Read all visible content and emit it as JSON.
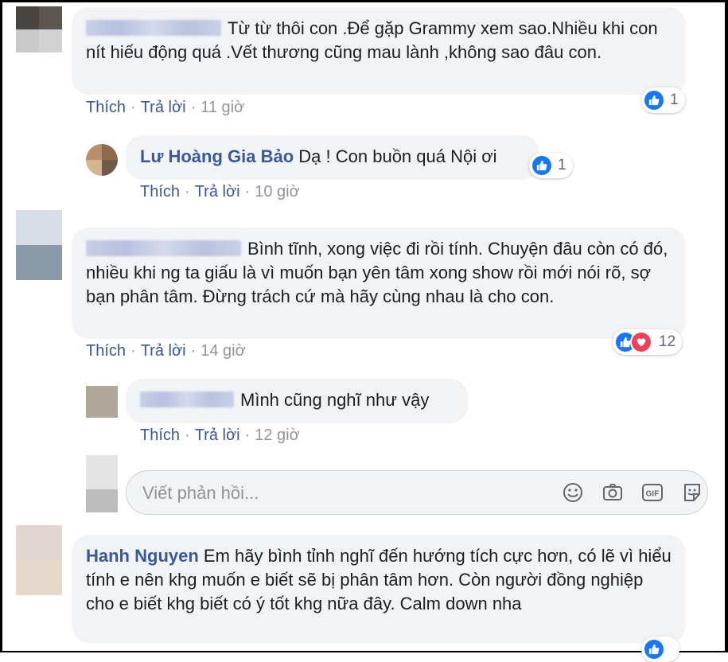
{
  "comments": [
    {
      "text": "Từ từ thôi con .Để gặp Grammy xem sao.Nhiều khi con nít hiếu động quá .Vết thương cũng mau lành ,không sao đâu con.",
      "like_label": "Thích",
      "reply_label": "Trả lời",
      "time": "11 giờ",
      "reaction_count": "1"
    },
    {
      "author": "Lư Hoàng Gia Bảo",
      "text": "Dạ ! Con buồn quá Nội ơi",
      "like_label": "Thích",
      "reply_label": "Trả lời",
      "time": "10 giờ",
      "reaction_count": "1"
    },
    {
      "text": "Bình tĩnh, xong việc đi rồi tính. Chuyện đâu còn có đó, nhiều khi ng ta giấu là vì muốn bạn yên tâm xong show rồi mới nói rõ, sợ bạn phân tâm. Đừng trách cứ mà hãy cùng nhau là cho con.",
      "like_label": "Thích",
      "reply_label": "Trả lời",
      "time": "14 giờ",
      "reaction_count": "12"
    },
    {
      "text": "Mình cũng nghĩ như vậy",
      "like_label": "Thích",
      "reply_label": "Trả lời",
      "time": "12 giờ"
    },
    {
      "author": "Hanh Nguyen",
      "text": "Em hãy bình tỉnh nghĩ đến hướng tích cực hơn, có lẽ vì hiểu tính e nên khg muốn e biết sẽ bị phân tâm hơn. Còn người đồng nghiệp cho e biết khg biết có ý tốt khg nữa đây. Calm down nha"
    }
  ],
  "reply_box": {
    "placeholder": "Viết phản hồi..."
  },
  "icons": [
    "like-icon",
    "love-icon",
    "emoji-icon",
    "camera-icon",
    "gif-icon",
    "sticker-icon"
  ],
  "colors": {
    "name": "#385898",
    "bubble": "#f2f3f5",
    "like": "#1877f2",
    "love": "#f33e58"
  }
}
